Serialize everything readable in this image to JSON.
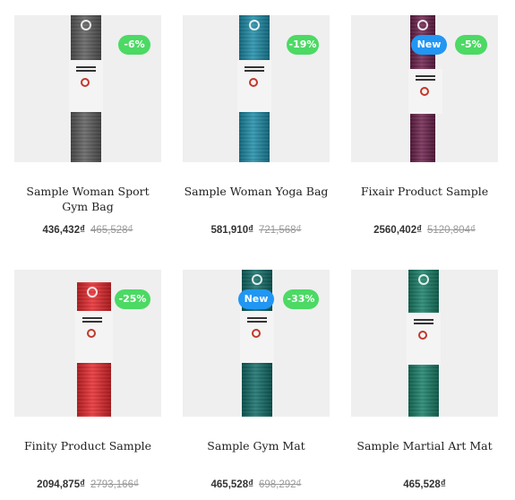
{
  "colors": {
    "discount_badge": "#4cd964",
    "new_badge": "#2196f3"
  },
  "products": [
    {
      "title": "Sample Woman Sport Gym Bag",
      "price": "436,432₫",
      "old_price": "465,528₫",
      "discount": "-6%",
      "new_label": "",
      "mat_color": "#5a5a5a"
    },
    {
      "title": "Sample Woman Yoga Bag",
      "price": "581,910₫",
      "old_price": "721,568₫",
      "discount": "-19%",
      "new_label": "",
      "mat_color": "#1b8aa6"
    },
    {
      "title": "Fixair Product Sample",
      "price": "2560,402₫",
      "old_price": "5120,804₫",
      "discount": "-5%",
      "new_label": "New",
      "mat_color": "#6a1f4a"
    },
    {
      "title": "Finity Product Sample",
      "price": "2094,875₫",
      "old_price": "2793,166₫",
      "discount": "-25%",
      "new_label": "",
      "mat_color": "#e5262b"
    },
    {
      "title": "Sample Gym Mat",
      "price": "465,528₫",
      "old_price": "698,292₫",
      "discount": "-33%",
      "new_label": "New",
      "mat_color": "#0f6a66"
    },
    {
      "title": "Sample Martial Art Mat",
      "price": "465,528₫",
      "old_price": "",
      "discount": "",
      "new_label": "",
      "mat_color": "#167d66"
    }
  ]
}
